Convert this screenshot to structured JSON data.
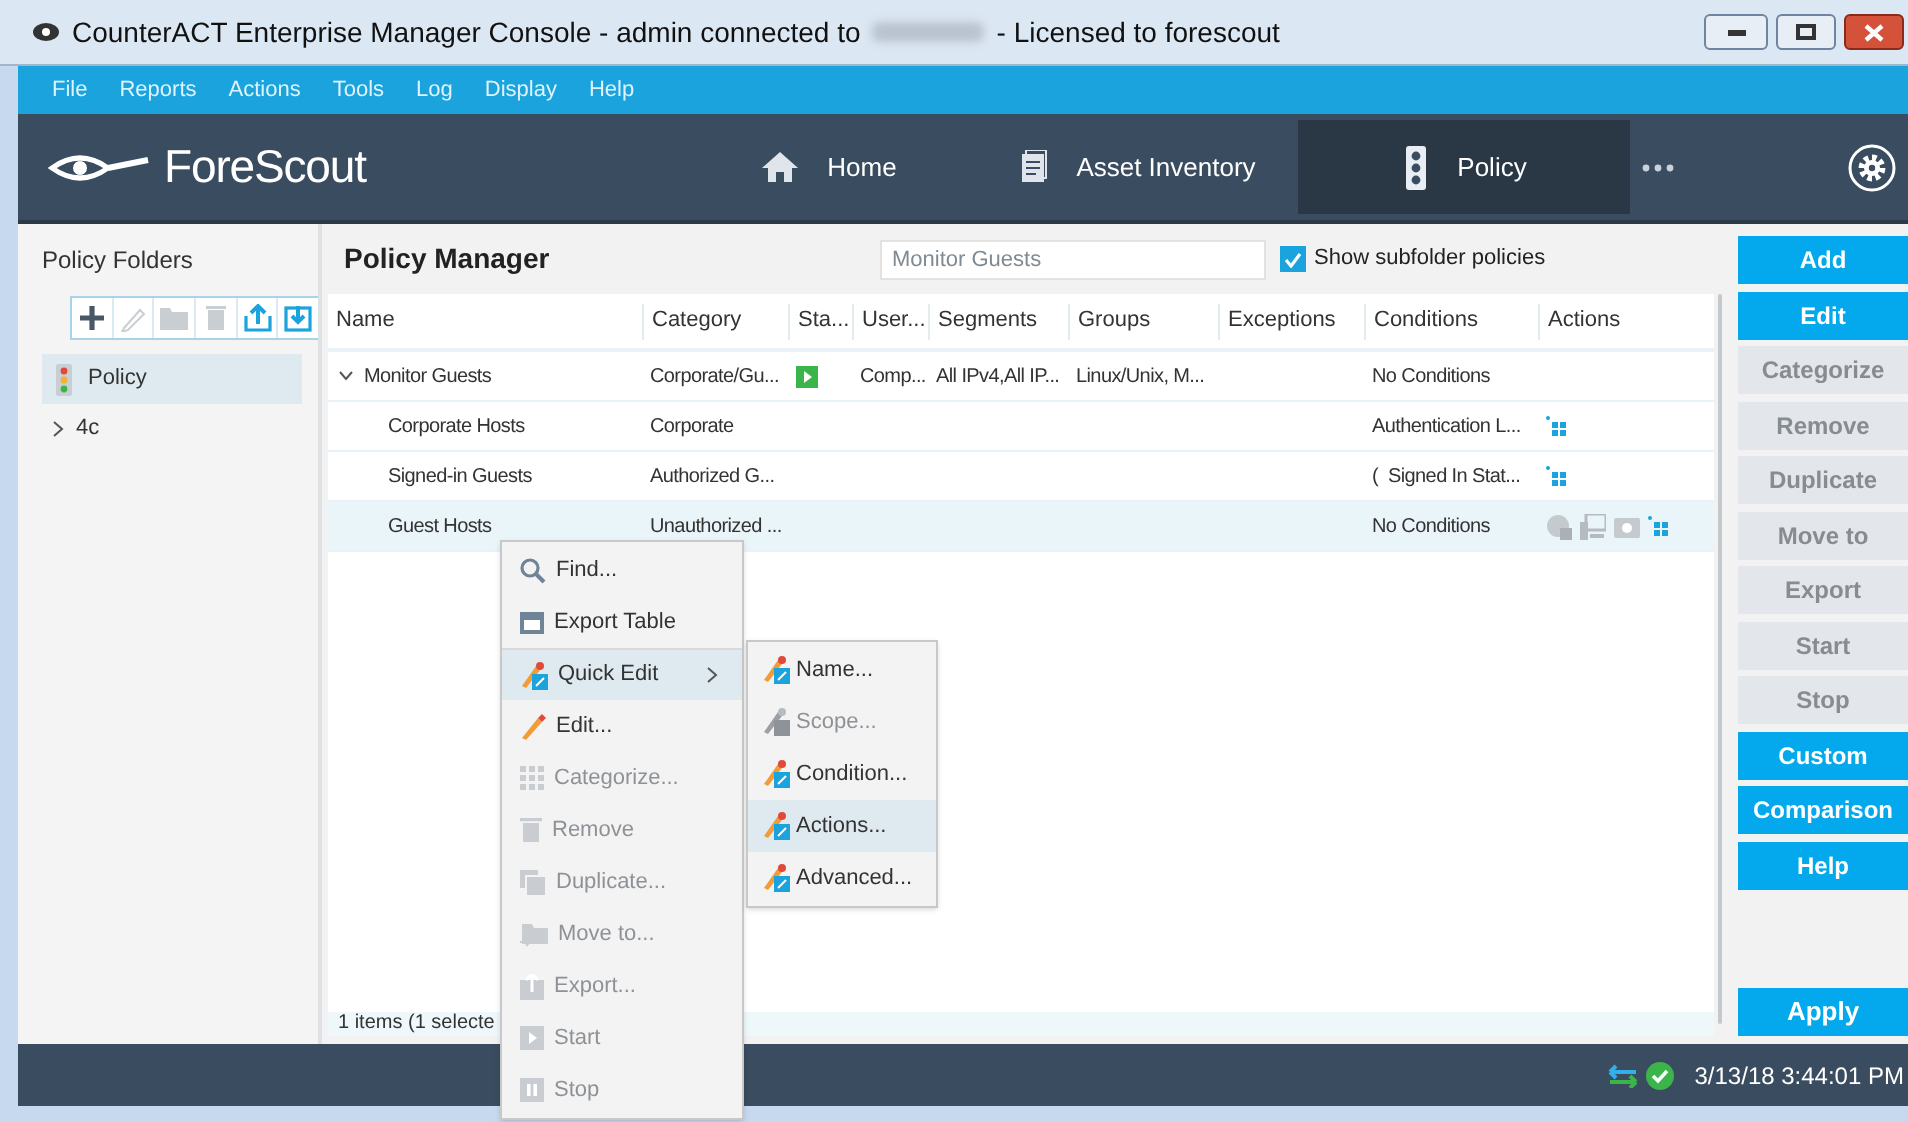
{
  "window": {
    "title_before": "CounterACT Enterprise Manager Console - admin connected to",
    "title_after": "- Licensed to forescout"
  },
  "menu": [
    "File",
    "Reports",
    "Actions",
    "Tools",
    "Log",
    "Display",
    "Help"
  ],
  "nav": {
    "logo": "ForeScout",
    "tabs": [
      {
        "label": "Home",
        "kind": "home",
        "selected": false
      },
      {
        "label": "Asset Inventory",
        "kind": "inventory",
        "selected": false
      },
      {
        "label": "Policy",
        "kind": "policy",
        "selected": true
      }
    ]
  },
  "folders": {
    "title": "Policy Folders",
    "toolbar": [
      {
        "kind": "add",
        "disabled": false
      },
      {
        "kind": "edit",
        "disabled": true
      },
      {
        "kind": "move",
        "disabled": true
      },
      {
        "kind": "delete",
        "disabled": true
      },
      {
        "kind": "export",
        "disabled": false
      },
      {
        "kind": "import",
        "disabled": false
      }
    ],
    "items": [
      {
        "label": "Policy",
        "kind": "policy",
        "selected": true
      },
      {
        "label": "4c",
        "kind": "folder",
        "selected": false
      }
    ]
  },
  "main": {
    "title": "Policy Manager",
    "search": {
      "value": "Monitor Guests"
    },
    "subfolders": {
      "label": "Show subfolder policies",
      "checked": true
    },
    "columns": [
      "Name",
      "Category",
      "Sta...",
      "User...",
      "Segments",
      "Groups",
      "Exceptions",
      "Conditions",
      "Actions"
    ],
    "rows": [
      {
        "kind": "group",
        "expanded": true,
        "selected": false,
        "running": true,
        "name": "Monitor Guests",
        "category": "Corporate/Gu...",
        "user": "Comp...",
        "segments": "All IPv4,All IP...",
        "groups": "Linux/Unix, M...",
        "conditions": "No Conditions",
        "actions": []
      },
      {
        "kind": "policy",
        "selected": false,
        "running": false,
        "name": "Corporate Hosts",
        "category": "Corporate",
        "conditions": "Authentication L...",
        "actions": [
          {
            "kind": "grid"
          }
        ]
      },
      {
        "kind": "policy",
        "selected": false,
        "running": false,
        "name": "Signed-in Guests",
        "category": "Authorized G...",
        "conditions": "(  Signed In Stat...",
        "actions": [
          {
            "kind": "grid"
          }
        ]
      },
      {
        "kind": "policy",
        "selected": true,
        "running": false,
        "name": "Guest Hosts",
        "category": "Unauthorized ...",
        "conditions": "No Conditions",
        "actions": [
          {
            "kind": "globe"
          },
          {
            "kind": "computer"
          },
          {
            "kind": "camera"
          },
          {
            "kind": "grid"
          }
        ]
      }
    ],
    "footer": "1 items (1 selecte"
  },
  "context_menu": [
    {
      "label": "Find...",
      "kind": "find",
      "disabled": false,
      "selected": false
    },
    {
      "label": "Export Table",
      "kind": "save",
      "disabled": false,
      "selected": false
    },
    {
      "label": "Quick Edit",
      "kind": "quick",
      "disabled": false,
      "selected": true,
      "submenu": true
    },
    {
      "label": "Edit...",
      "kind": "pencil",
      "disabled": false,
      "selected": false
    },
    {
      "label": "Categorize...",
      "kind": "grid",
      "disabled": true,
      "selected": false
    },
    {
      "label": "Remove",
      "kind": "trash",
      "disabled": true,
      "selected": false
    },
    {
      "label": "Duplicate...",
      "kind": "copy",
      "disabled": true,
      "selected": false
    },
    {
      "label": "Move to...",
      "kind": "folder",
      "disabled": true,
      "selected": false
    },
    {
      "label": "Export...",
      "kind": "export",
      "disabled": true,
      "selected": false
    },
    {
      "label": "Start",
      "kind": "play",
      "disabled": true,
      "selected": false
    },
    {
      "label": "Stop",
      "kind": "pause",
      "disabled": true,
      "selected": false
    }
  ],
  "submenu": [
    {
      "label": "Name...",
      "disabled": false,
      "selected": false
    },
    {
      "label": "Scope...",
      "disabled": true,
      "selected": false
    },
    {
      "label": "Condition...",
      "disabled": false,
      "selected": false
    },
    {
      "label": "Actions...",
      "disabled": false,
      "selected": true
    },
    {
      "label": "Advanced...",
      "disabled": false,
      "selected": false
    }
  ],
  "buttons": [
    {
      "label": "Add",
      "disabled": false
    },
    {
      "label": "Edit",
      "disabled": false
    },
    {
      "label": "Categorize",
      "disabled": true
    },
    {
      "label": "Remove",
      "disabled": true
    },
    {
      "label": "Duplicate",
      "disabled": true
    },
    {
      "label": "Move to",
      "disabled": true
    },
    {
      "label": "Export",
      "disabled": true
    },
    {
      "label": "Start",
      "disabled": true
    },
    {
      "label": "Stop",
      "disabled": true
    },
    {
      "label": "Custom",
      "disabled": false
    },
    {
      "label": "Comparison",
      "disabled": false
    },
    {
      "label": "Help",
      "disabled": false
    }
  ],
  "apply_button": {
    "label": "Apply",
    "disabled": false
  },
  "status_bar": {
    "time": "3/13/18 3:44:01 PM"
  }
}
